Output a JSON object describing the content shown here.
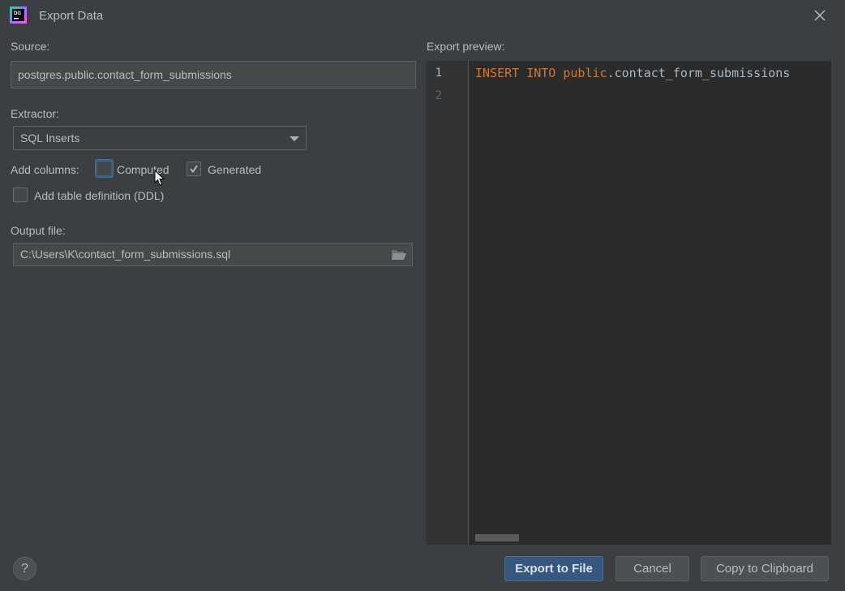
{
  "window": {
    "title": "Export Data"
  },
  "source": {
    "label": "Source:",
    "value": "postgres.public.contact_form_submissions"
  },
  "extractor": {
    "label": "Extractor:",
    "selected": "SQL Inserts"
  },
  "add_columns": {
    "label": "Add columns:",
    "computed": {
      "label": "Computed",
      "checked": false
    },
    "generated": {
      "label": "Generated",
      "checked": true
    }
  },
  "ddl": {
    "label": "Add table definition (DDL)",
    "checked": false
  },
  "output": {
    "label": "Output file:",
    "value": "C:\\Users\\K\\contact_form_submissions.sql"
  },
  "preview": {
    "label": "Export preview:",
    "line_numbers": [
      "1",
      "2"
    ],
    "code": {
      "kw1": "INSERT",
      "kw2": "INTO",
      "schema": "public",
      "rest": ".contact_form_submissions"
    }
  },
  "buttons": {
    "help": "?",
    "export": "Export to File",
    "cancel": "Cancel",
    "copy": "Copy to Clipboard"
  },
  "icons": {
    "app": "datagrip-logo-icon",
    "close": "close-icon",
    "dropdown": "chevron-down-icon",
    "folder": "folder-open-icon",
    "checkmark": "checkmark-icon",
    "cursor": "mouse-cursor-icon"
  },
  "colors": {
    "background": "#3c3f41",
    "editor": "#2b2b2b",
    "keyword": "#cc7832",
    "primary_button": "#365880"
  }
}
